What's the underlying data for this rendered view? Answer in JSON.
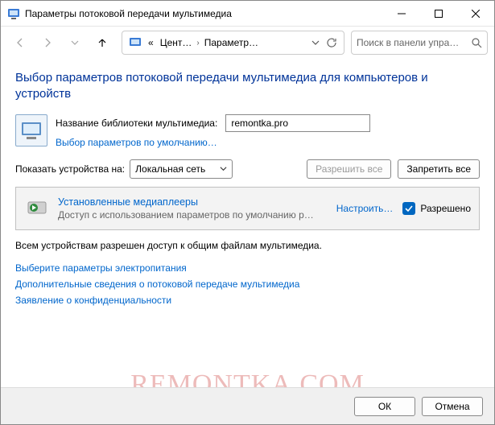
{
  "window": {
    "title": "Параметры потоковой передачи мультимедиа"
  },
  "breadcrumb": {
    "seg1_prefix": "«",
    "seg1": "Цент…",
    "seg2": "Параметр…"
  },
  "search": {
    "placeholder": "Поиск в панели упра…"
  },
  "heading": "Выбор параметров потоковой передачи мультимедиа для компьютеров и устройств",
  "library": {
    "label": "Название библиотеки мультимедиа:",
    "value": "remontka.pro",
    "defaults_link": "Выбор параметров по умолчанию…"
  },
  "show": {
    "label": "Показать устройства на:",
    "selected": "Локальная сеть",
    "allow_all": "Разрешить все",
    "block_all": "Запретить все"
  },
  "device": {
    "title": "Установленные медиаплееры",
    "subtitle": "Доступ с использованием параметров по умолчанию р…",
    "configure": "Настроить…",
    "allowed": "Разрешено"
  },
  "status": "Всем устройствам разрешен доступ к общим файлам мультимедиа.",
  "links": {
    "power": "Выберите параметры электропитания",
    "more": "Дополнительные сведения о потоковой передаче мультимедиа",
    "privacy": "Заявление о конфиденциальности"
  },
  "buttons": {
    "ok": "ОК",
    "cancel": "Отмена"
  },
  "watermark": "REMONTKA.COM"
}
